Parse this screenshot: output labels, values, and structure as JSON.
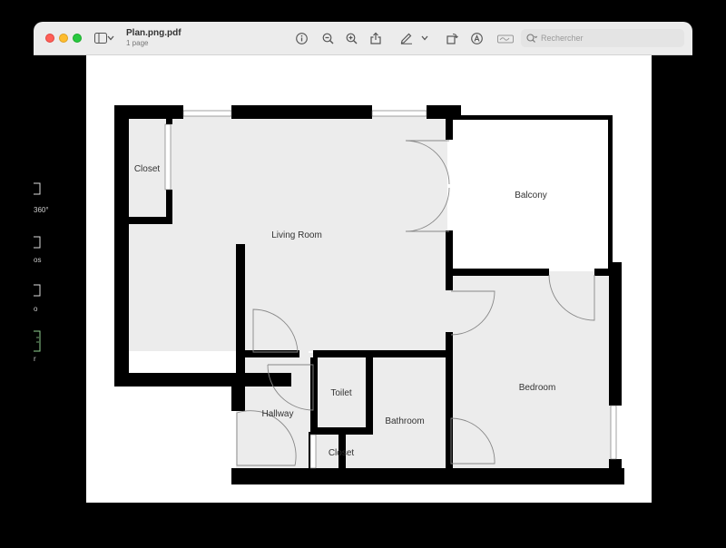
{
  "window": {
    "title": "Plan.png.pdf",
    "subtitle": "1 page",
    "search_placeholder": "Rechercher"
  },
  "toolbar": {
    "icons": [
      "sidebar-toggle-icon",
      "chevron-down-icon",
      "info-icon",
      "zoom-out-icon",
      "zoom-in-icon",
      "share-icon",
      "markup-pen-icon",
      "chevron-down-icon",
      "rotate-icon",
      "highlight-circle-icon",
      "signature-icon",
      "search-icon"
    ]
  },
  "sidebar": {
    "thumb_labels": [
      "360°",
      "os",
      "o",
      "r"
    ]
  },
  "plan": {
    "rooms": [
      "Closet",
      "Living Room",
      "Balcony",
      "Bedroom",
      "Toilet",
      "Hallway",
      "Bathroom",
      "Closet"
    ]
  },
  "colors": {
    "wall": "#000000",
    "room_fill": "#ececec",
    "titlebar": "#ececec"
  }
}
